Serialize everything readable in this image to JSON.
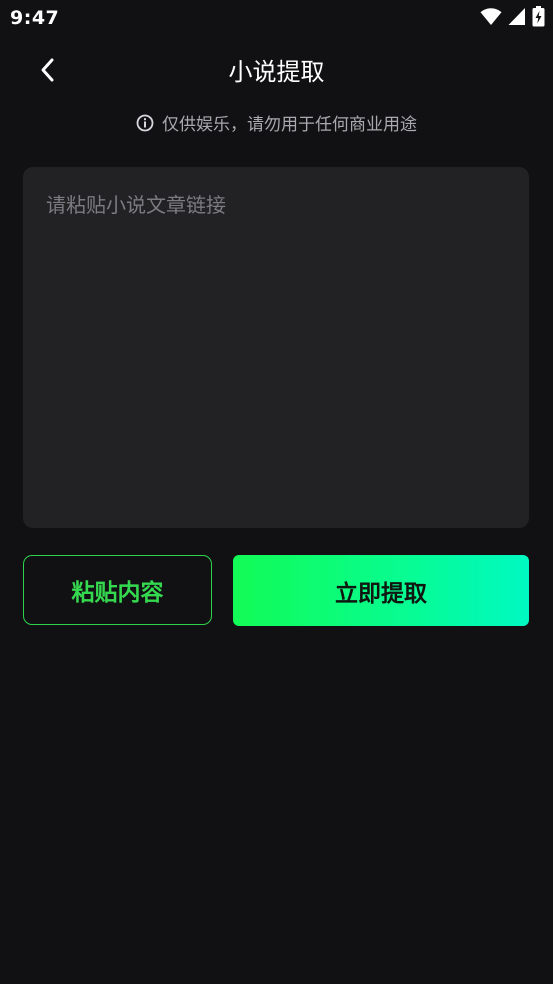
{
  "status_bar": {
    "time": "9:47"
  },
  "header": {
    "title": "小说提取"
  },
  "notice": {
    "text": "仅供娱乐，请勿用于任何商业用途"
  },
  "input": {
    "value": "",
    "placeholder": "请粘贴小说文章链接"
  },
  "actions": {
    "paste_label": "粘贴内容",
    "extract_label": "立即提取"
  },
  "colors": {
    "background": "#111113",
    "input_background": "#222225",
    "accent_green": "#35d94f",
    "gradient_start": "#12fb55",
    "gradient_end": "#00f9c2"
  },
  "icons": {
    "back": "chevron-left-icon",
    "notice": "info-icon",
    "wifi": "wifi-icon",
    "signal": "signal-icon",
    "battery": "battery-charging-icon"
  }
}
